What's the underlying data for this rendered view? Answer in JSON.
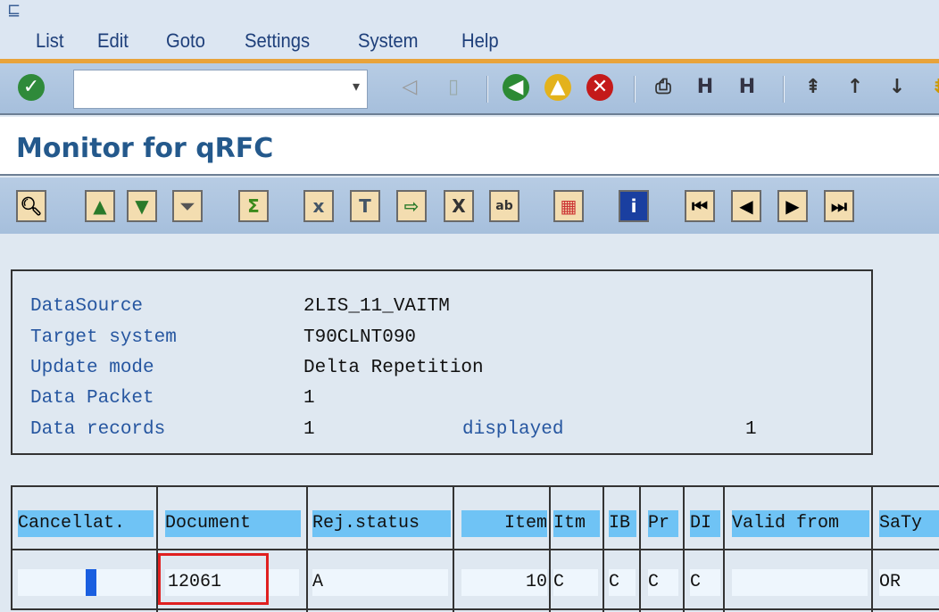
{
  "menu": [
    "List",
    "Edit",
    "Goto",
    "Settings",
    "System",
    "Help"
  ],
  "command_field": {
    "value": ""
  },
  "title": "Monitor for qRFC",
  "info": {
    "labels": [
      "DataSource",
      "Target system",
      "Update mode",
      "Data Packet",
      "Data records"
    ],
    "values": [
      "2LIS_11_VAITM",
      "T90CLNT090",
      "Delta Repetition",
      "1",
      "1"
    ],
    "displayed_label": "displayed",
    "displayed_value": "1"
  },
  "table": {
    "headers": [
      "Cancellat.",
      "Document",
      "Rej.status",
      "Item",
      "Itm",
      "IB",
      "Pr",
      "DI",
      "Valid from",
      "SaTy"
    ],
    "row": [
      "",
      "12061",
      "A",
      "10",
      "C",
      "C",
      "C",
      "C",
      "",
      "OR"
    ]
  },
  "colors": {
    "accent": "#e8a33a",
    "header_cell": "#6fc3f5",
    "highlight": "#e02020"
  }
}
